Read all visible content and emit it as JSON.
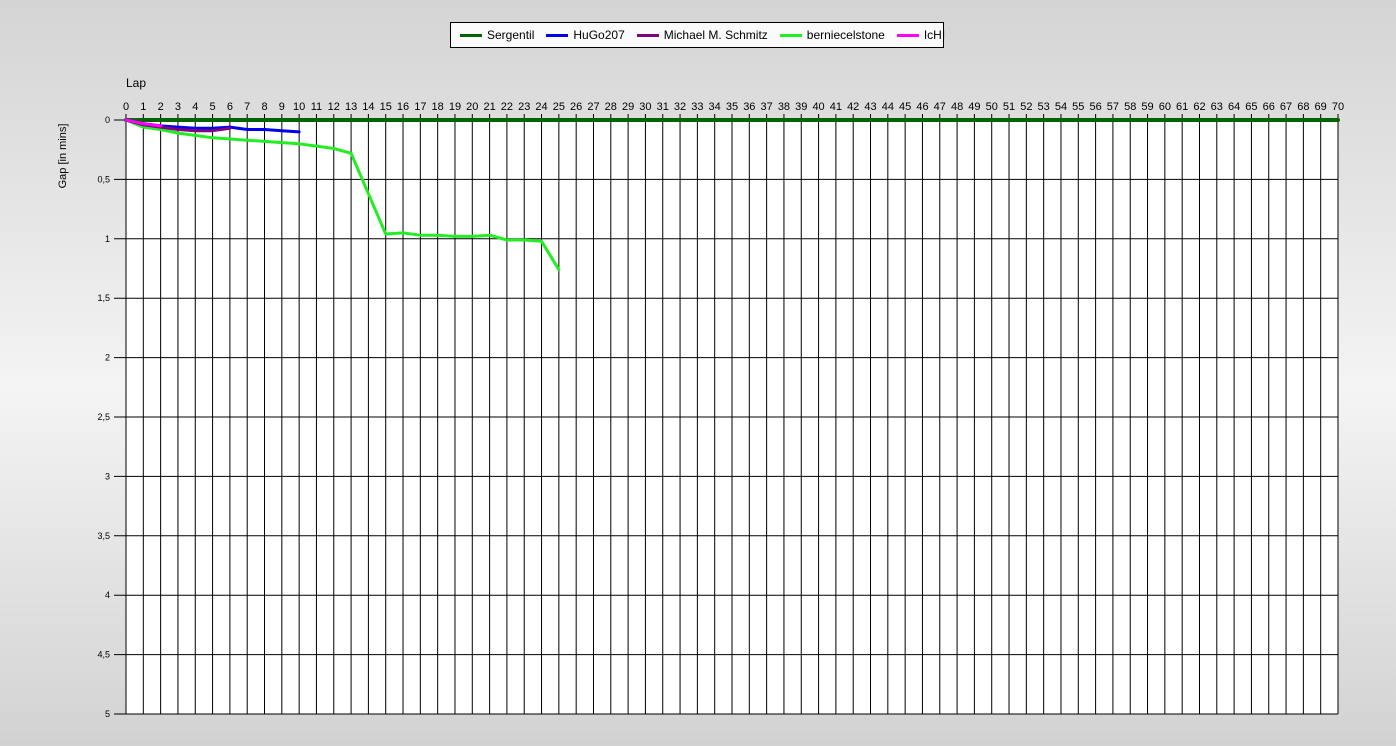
{
  "chart_data": {
    "type": "line",
    "title": "",
    "xlabel": "Lap",
    "ylabel": "Gap [in mins]",
    "x_axis_position": "top",
    "y_inverted": true,
    "xlim": [
      0,
      70
    ],
    "ylim": [
      0,
      5
    ],
    "x_ticks": [
      0,
      1,
      2,
      3,
      4,
      5,
      6,
      7,
      8,
      9,
      10,
      11,
      12,
      13,
      14,
      15,
      16,
      17,
      18,
      19,
      20,
      21,
      22,
      23,
      24,
      25,
      26,
      27,
      28,
      29,
      30,
      31,
      32,
      33,
      34,
      35,
      36,
      37,
      38,
      39,
      40,
      41,
      42,
      43,
      44,
      45,
      46,
      47,
      48,
      49,
      50,
      51,
      52,
      53,
      54,
      55,
      56,
      57,
      58,
      59,
      60,
      61,
      62,
      63,
      64,
      65,
      66,
      67,
      68,
      69,
      70
    ],
    "y_ticks": [
      {
        "value": 0,
        "label": "0"
      },
      {
        "value": 0.5,
        "label": "0,5"
      },
      {
        "value": 1,
        "label": "1"
      },
      {
        "value": 1.5,
        "label": "1,5"
      },
      {
        "value": 2,
        "label": "2"
      },
      {
        "value": 2.5,
        "label": "2,5"
      },
      {
        "value": 3,
        "label": "3"
      },
      {
        "value": 3.5,
        "label": "3,5"
      },
      {
        "value": 4,
        "label": "4"
      },
      {
        "value": 4.5,
        "label": "4,5"
      },
      {
        "value": 5,
        "label": "5"
      }
    ],
    "grid": true,
    "legend_position": "top-center",
    "series": [
      {
        "name": "Sergentil",
        "color": "#006400",
        "points": [
          [
            0,
            0
          ],
          [
            70,
            0
          ]
        ]
      },
      {
        "name": "berniecelstone",
        "color": "#22ee22",
        "points": [
          [
            0,
            0
          ],
          [
            1,
            0.06
          ],
          [
            2,
            0.08
          ],
          [
            3,
            0.11
          ],
          [
            4,
            0.13
          ],
          [
            5,
            0.15
          ],
          [
            6,
            0.16
          ],
          [
            7,
            0.17
          ],
          [
            8,
            0.18
          ],
          [
            9,
            0.19
          ],
          [
            10,
            0.2
          ],
          [
            11,
            0.22
          ],
          [
            12,
            0.24
          ],
          [
            13,
            0.28
          ],
          [
            14,
            0.62
          ],
          [
            15,
            0.96
          ],
          [
            16,
            0.95
          ],
          [
            17,
            0.97
          ],
          [
            18,
            0.97
          ],
          [
            19,
            0.98
          ],
          [
            20,
            0.98
          ],
          [
            21,
            0.97
          ],
          [
            22,
            1.01
          ],
          [
            23,
            1.01
          ],
          [
            24,
            1.02
          ],
          [
            25,
            1.26
          ]
        ]
      },
      {
        "name": "HuGo207",
        "color": "#0000ee",
        "points": [
          [
            0,
            0
          ],
          [
            1,
            0.03
          ],
          [
            2,
            0.05
          ],
          [
            3,
            0.06
          ],
          [
            4,
            0.07
          ],
          [
            5,
            0.07
          ],
          [
            6,
            0.06
          ],
          [
            7,
            0.08
          ],
          [
            8,
            0.08
          ],
          [
            9,
            0.09
          ],
          [
            10,
            0.1
          ]
        ]
      },
      {
        "name": "Michael M. Schmitz",
        "color": "#800080",
        "points": [
          [
            0,
            0
          ],
          [
            1,
            0.04
          ],
          [
            2,
            0.06
          ],
          [
            3,
            0.08
          ],
          [
            4,
            0.09
          ],
          [
            5,
            0.09
          ],
          [
            6,
            0.07
          ]
        ]
      },
      {
        "name": "IcHI",
        "color": "#ff00ff",
        "points": [
          [
            0,
            0
          ],
          [
            1,
            0.03
          ],
          [
            2,
            0.05
          ]
        ]
      }
    ],
    "legend_order": [
      "Sergentil",
      "HuGo207",
      "Michael M. Schmitz",
      "berniecelstone",
      "IcHI"
    ]
  }
}
